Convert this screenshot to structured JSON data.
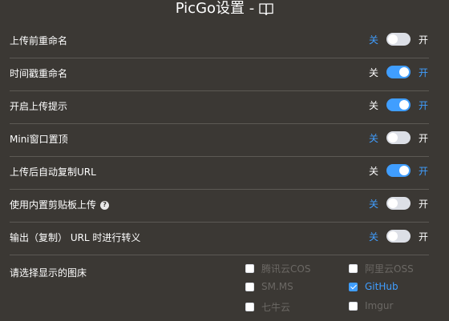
{
  "header": {
    "title": "PicGo设置 -",
    "icon": "book-icon"
  },
  "colors": {
    "background": "#3b3834",
    "accent": "#409eff",
    "divider": "#5c5954"
  },
  "settings": [
    {
      "label": "上传前重命名",
      "off_label": "关",
      "on_label": "开",
      "state": "off"
    },
    {
      "label": "时间戳重命名",
      "off_label": "关",
      "on_label": "开",
      "state": "on"
    },
    {
      "label": "开启上传提示",
      "off_label": "关",
      "on_label": "开",
      "state": "on"
    },
    {
      "label": "Mini窗口置顶",
      "off_label": "关",
      "on_label": "开",
      "state": "off"
    },
    {
      "label": "上传后自动复制URL",
      "off_label": "关",
      "on_label": "开",
      "state": "on"
    },
    {
      "label": "使用内置剪贴板上传",
      "off_label": "关",
      "on_label": "开",
      "state": "off",
      "help_icon": "question-icon",
      "help_glyph": "?"
    },
    {
      "label": "输出（复制） URL 时进行转义",
      "off_label": "关",
      "on_label": "开",
      "state": "off"
    }
  ],
  "image_beds": {
    "label": "请选择显示的图床",
    "items": [
      {
        "name": "腾讯云COS",
        "checked": false
      },
      {
        "name": "阿里云OSS",
        "checked": false
      },
      {
        "name": "SM.MS",
        "checked": false
      },
      {
        "name": "GitHub",
        "checked": true
      },
      {
        "name": "七牛云",
        "checked": false
      },
      {
        "name": "Imgur",
        "checked": false
      }
    ]
  }
}
